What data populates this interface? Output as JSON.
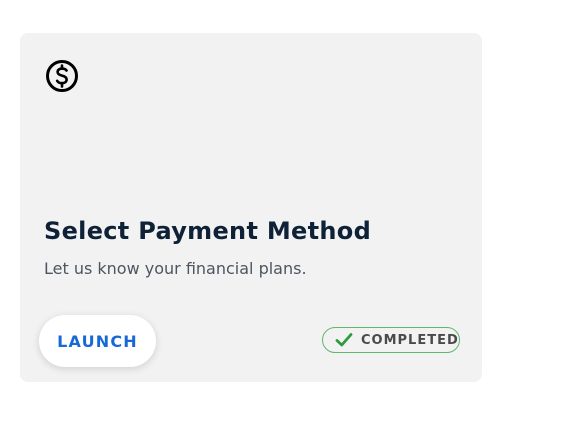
{
  "card": {
    "icon": "dollar-circle-icon",
    "title": "Select Payment Method",
    "subtitle": "Let us know your financial plans.",
    "launch_label": "LAUNCH",
    "status_label": "COMPLETED",
    "status_icon": "check-icon",
    "colors": {
      "card_background": "#f2f2f2",
      "accent": "#1769d6",
      "status_border": "#5fb86d",
      "status_check": "#2e9b3f",
      "title": "#0e2137"
    }
  }
}
